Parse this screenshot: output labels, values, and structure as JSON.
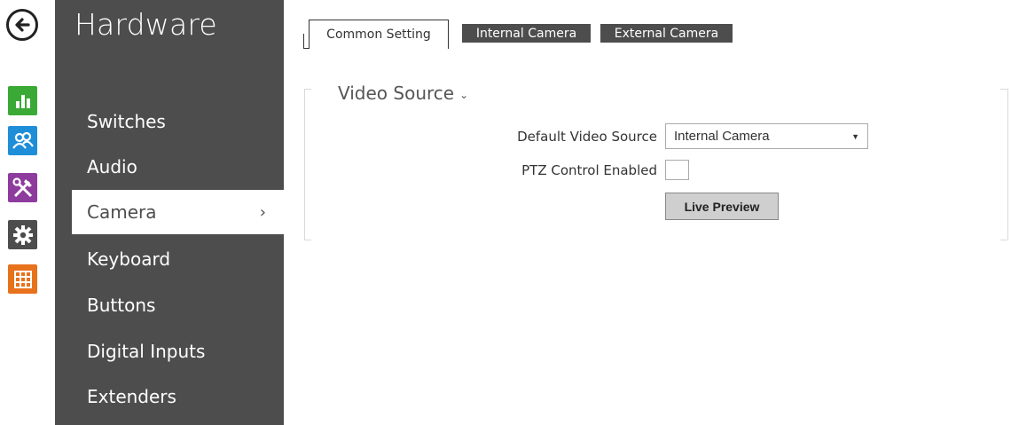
{
  "menu": {
    "title": "Hardware",
    "items": [
      {
        "label": "Switches"
      },
      {
        "label": "Audio"
      },
      {
        "label": "Camera",
        "chevron": "›"
      },
      {
        "label": "Keyboard"
      },
      {
        "label": "Buttons"
      },
      {
        "label": "Digital Inputs"
      },
      {
        "label": "Extenders"
      }
    ]
  },
  "rail": {
    "back_icon": "back-arrow-icon",
    "icons": [
      {
        "name": "status-chart-icon",
        "color": "#3aa935"
      },
      {
        "name": "users-icon",
        "color": "#1f8ed8"
      },
      {
        "name": "services-tools-icon",
        "color": "#8e3b9e"
      },
      {
        "name": "settings-gear-icon",
        "color": "#4d4d4d"
      },
      {
        "name": "system-grid-icon",
        "color": "#e8711c"
      }
    ]
  },
  "tabs": [
    "Common Setting",
    "Internal Camera",
    "External Camera"
  ],
  "section": {
    "title": "Video Source",
    "caret": "⌄"
  },
  "form": {
    "default_video_source_label": "Default Video Source",
    "default_video_source_value": "Internal Camera",
    "select_arrow": "▼",
    "ptz_label": "PTZ Control Enabled",
    "live_preview_label": "Live Preview"
  }
}
